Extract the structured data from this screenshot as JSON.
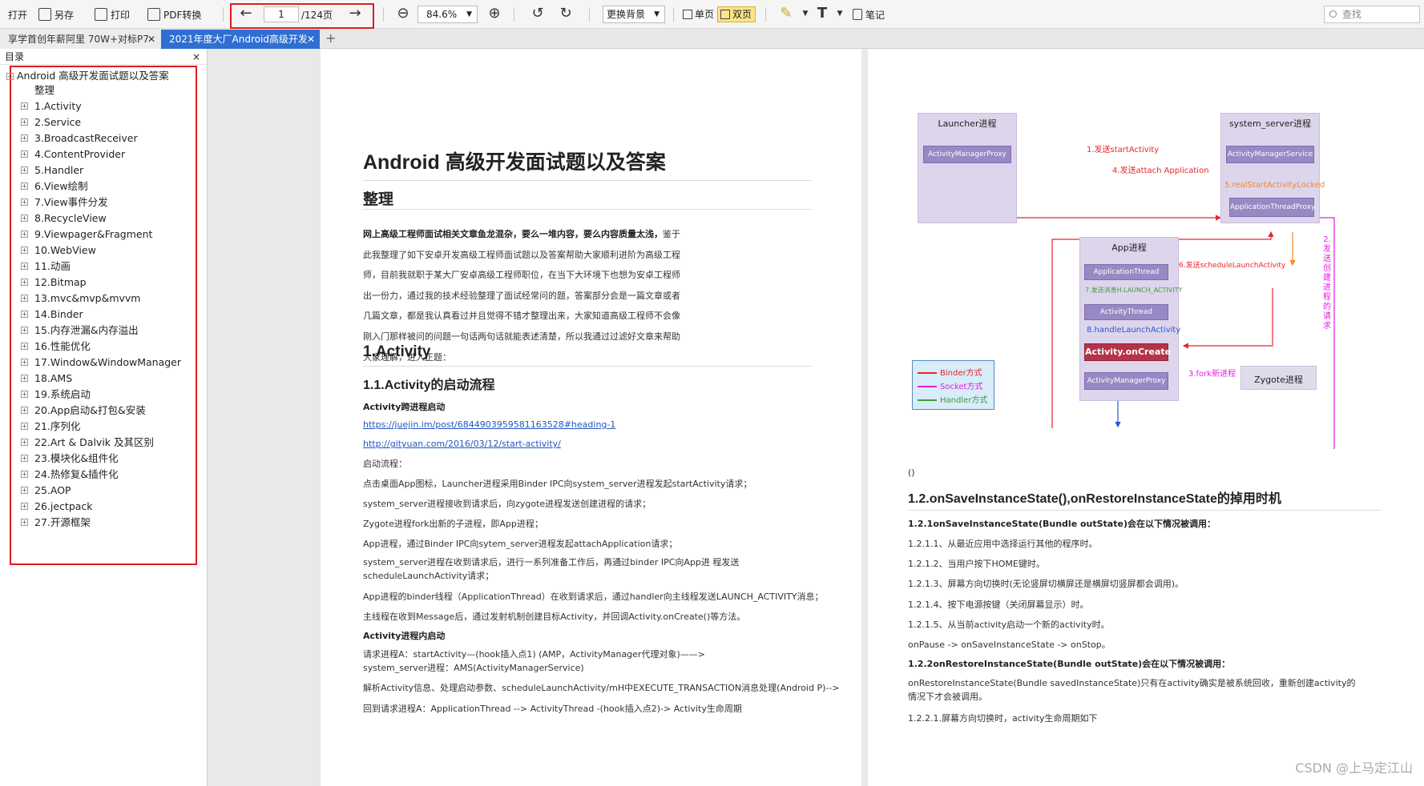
{
  "toolbar": {
    "open": "打开",
    "save_as": "另存",
    "print": "打印",
    "pdf_convert": "PDF转换",
    "page_current": "1",
    "page_total": "/124页",
    "zoom": "84.6%",
    "change_bg": "更换背景",
    "single_page": "单页",
    "double_page": "双页",
    "notes": "笔记",
    "search_placeholder": "查找"
  },
  "tabs": [
    {
      "label": "享学首创年薪阿里 70W+对标P7"
    },
    {
      "label": "2021年度大厂Android高级开发"
    }
  ],
  "sidebar": {
    "title": "目录",
    "root": "Android 高级开发面试题以及答案",
    "items": [
      "整理",
      "1.Activity",
      "2.Service",
      "3.BroadcastReceiver",
      "4.ContentProvider",
      "5.Handler",
      "6.View绘制",
      "7.View事件分发",
      "8.RecycleView",
      "9.Viewpager&Fragment",
      "10.WebView",
      "11.动画",
      "12.Bitmap",
      "13.mvc&mvp&mvvm",
      "14.Binder",
      "15.内存泄漏&内存溢出",
      "16.性能优化",
      "17.Window&WindowManager",
      "18.AMS",
      "19.系统启动",
      "20.App启动&打包&安装",
      "21.序列化",
      "22.Art & Dalvik 及其区别",
      "23.模块化&组件化",
      "24.热修复&插件化",
      "25.AOP",
      "26.jectpack",
      "27.开源框架"
    ]
  },
  "left_page": {
    "title": "Android 高级开发面试题以及答案",
    "section_arrange": "整理",
    "intro_bold": "网上高级工程师面试相关文章鱼龙混杂，要么一堆内容，要么内容质量太浅，",
    "intro_rest": "鉴于此我整理了如下安卓开发高级工程师面试题以及答案帮助大家顺利进阶为高级工程师，目前我就职于某大厂安卓高级工程师职位，在当下大环境下也想为安卓工程师出一份力，通过我的技术经验整理了面试经常问的题，答案部分会是一篇文章或者几篇文章，都是我认真看过并且觉得不错才整理出来，大家知道高级工程师不会像刚入门那样被问的问题一句话两句话就能表述清楚，所以我通过过滤好文章来帮助大家理解，进入正题：",
    "section_activity": "1.Activity",
    "sub_launch": "1.1.Activity的启动流程",
    "cross_process": "Activity跨进程启动",
    "link1": "https://juejin.im/post/6844903959581163528#heading-1",
    "link2": "http://gityuan.com/2016/03/12/start-activity/",
    "flow_label": "启动流程：",
    "flow_lines": [
      "点击桌面App图标，Launcher进程采用Binder IPC向system_server进程发起startActivity请求；",
      "system_server进程接收到请求后，向zygote进程发送创建进程的请求；",
      "Zygote进程fork出新的子进程，即App进程；",
      "App进程，通过Binder IPC向sytem_server进程发起attachApplication请求；",
      "system_server进程在收到请求后，进行一系列准备工作后，再通过binder IPC向App进 程发送scheduleLaunchActivity请求；",
      "App进程的binder线程（ApplicationThread）在收到请求后，通过handler向主线程发送LAUNCH_ACTIVITY消息；",
      "主线程在收到Message后，通过发射机制创建目标Activity，并回调Activity.onCreate()等方法。"
    ],
    "in_process": "Activity进程内启动",
    "in_lines": [
      "请求进程A：startActivity—(hook插入点1) (AMP，ActivityManager代理对象)——> system_server进程：AMS(ActivityManagerService)",
      "解析Activity信息、处理启动参数、scheduleLaunchActivity/mH中EXECUTE_TRANSACTION消息处理(Android P)-->",
      "回到请求进程A：ApplicationThread --> ActivityThread -(hook插入点2)-> Activity生命周期"
    ]
  },
  "diagram": {
    "launcher_title": "Launcher进程",
    "system_server_title": "system_server进程",
    "app_title": "App进程",
    "zygote": "Zygote进程",
    "amp": "ActivityManagerProxy",
    "ams": "ActivityManagerService",
    "atp": "ApplicationThreadProxy",
    "app_thread": "ApplicationThread",
    "activity_thread": "ActivityThread",
    "on_create": "Activity.onCreate",
    "amp2": "ActivityManagerProxy",
    "l1": "1.发送startActivity",
    "l4": "4.发送attach Application",
    "l5": "5.realStartActivityLocked",
    "l6": "6.发送scheduleLaunchActivity",
    "l7": "7.发送消息H.LAUNCH_ACTIVITY",
    "l8": "8.handleLaunchActivity",
    "l3": "3.fork新进程",
    "l2": "2.发送创建进程的请求",
    "legend_binder": "Binder方式",
    "legend_socket": "Socket方式",
    "legend_handler": "Handler方式",
    "colors": {
      "binder": "#e8262a",
      "socket": "#e020e0",
      "handler": "#3f9c35",
      "realstart": "#f08a26",
      "handle": "#2b56c8"
    }
  },
  "right_page": {
    "parens": "()",
    "section_title": "1.2.onSaveInstanceState(),onRestoreInstanceState的掉用时机",
    "save_head": "1.2.1onSaveInstanceState(Bundle outState)会在以下情况被调用：",
    "save_lines": [
      "1.2.1.1、从最近应用中选择运行其他的程序时。",
      "1.2.1.2、当用户按下HOME键时。",
      "1.2.1.3、屏幕方向切换时(无论竖屏切横屏还是横屏切竖屏都会调用)。",
      "1.2.1.4、按下电源按键（关闭屏幕显示）时。",
      "1.2.1.5、从当前activity启动一个新的activity时。"
    ],
    "pause_line": "onPause -> onSaveInstanceState -> onStop。",
    "restore_head": "1.2.2onRestoreInstanceState(Bundle outState)会在以下情况被调用：",
    "restore_line": "onRestoreInstanceState(Bundle savedInstanceState)只有在activity确实是被系统回收，重新创建activity的情况下才会被调用。",
    "rotate_line": "1.2.2.1.屏幕方向切换时，activity生命周期如下"
  },
  "watermark": "CSDN @上马定江山"
}
